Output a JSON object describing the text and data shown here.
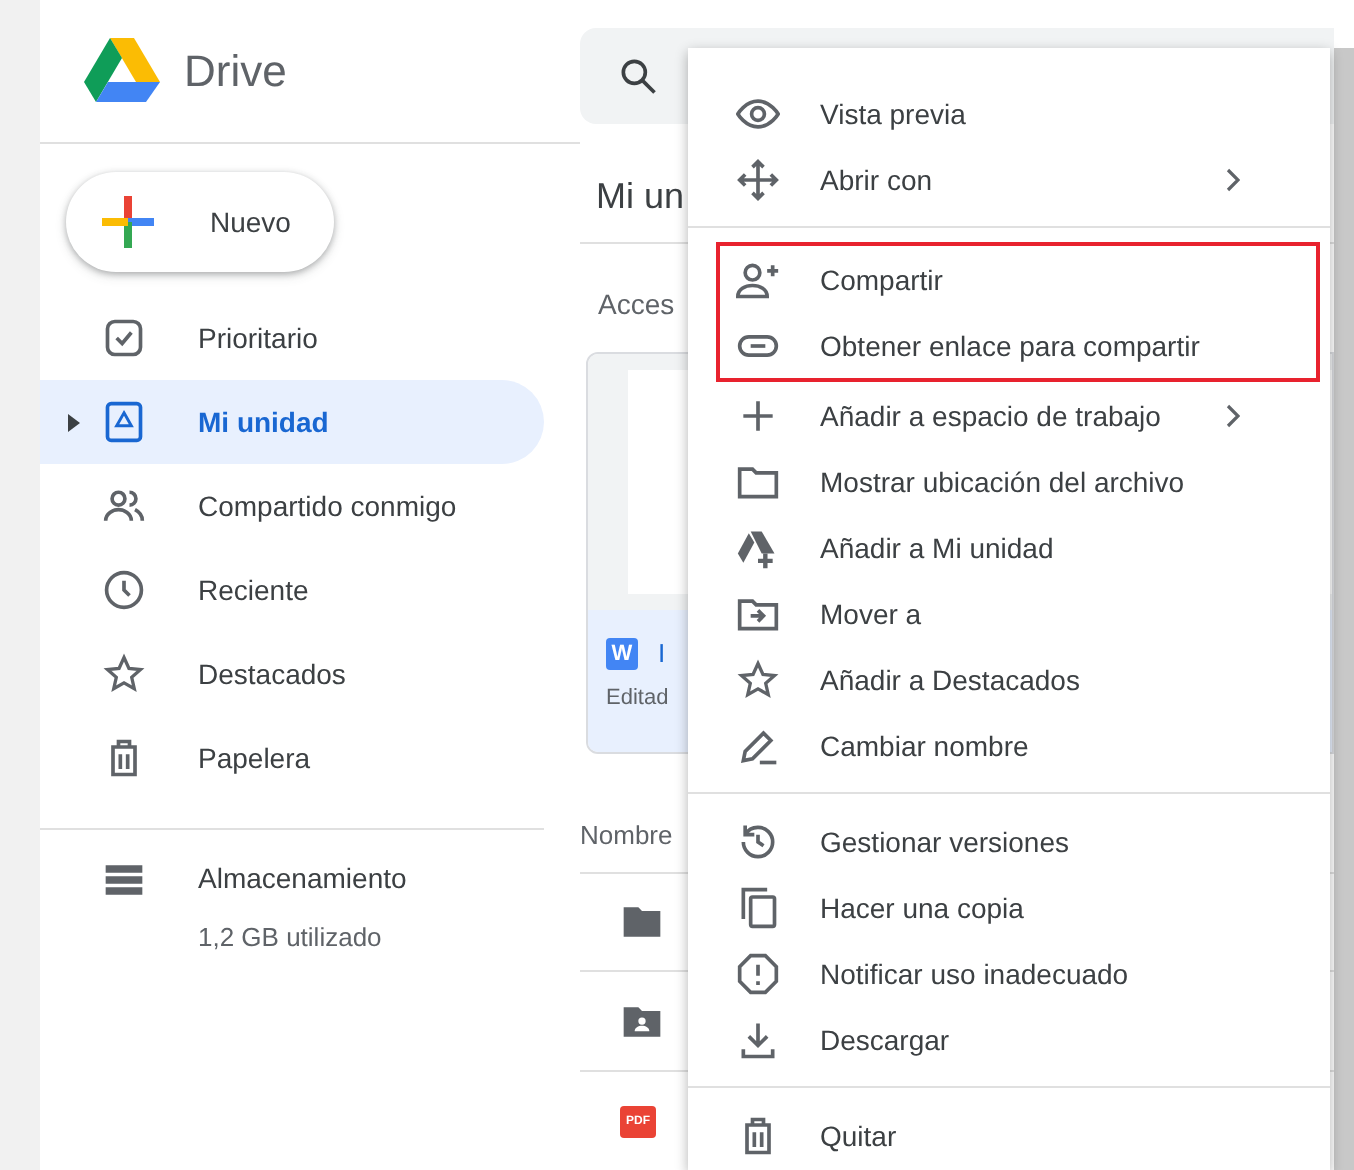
{
  "logo": {
    "name": "Drive"
  },
  "new_button": {
    "label": "Nuevo"
  },
  "sidebar": {
    "items": [
      {
        "label": "Prioritario",
        "selected": false
      },
      {
        "label": "Mi unidad",
        "selected": true
      },
      {
        "label": "Compartido conmigo",
        "selected": false
      },
      {
        "label": "Reciente",
        "selected": false
      },
      {
        "label": "Destacados",
        "selected": false
      },
      {
        "label": "Papelera",
        "selected": false
      }
    ],
    "storage": {
      "label": "Almacenamiento",
      "usage": "1,2 GB utilizado"
    }
  },
  "main": {
    "title": "Mi un",
    "section": "Acces",
    "card": {
      "badge": "W",
      "name": "I",
      "subtitle": "Editad"
    },
    "column": "Nombre",
    "files": [
      {
        "kind": "folder"
      },
      {
        "kind": "shared-folder"
      },
      {
        "kind": "pdf",
        "badge": "PDF"
      }
    ]
  },
  "menu": {
    "sections": [
      {
        "items": [
          {
            "label": "Vista previa",
            "submenu": false,
            "highlighted": false
          },
          {
            "label": "Abrir con",
            "submenu": true,
            "highlighted": false
          }
        ]
      },
      {
        "items": [
          {
            "label": "Compartir",
            "submenu": false,
            "highlighted": true
          },
          {
            "label": "Obtener enlace para compartir",
            "submenu": false,
            "highlighted": true
          },
          {
            "label": "Añadir a espacio de trabajo",
            "submenu": true,
            "highlighted": false
          },
          {
            "label": "Mostrar ubicación del archivo",
            "submenu": false,
            "highlighted": false
          },
          {
            "label": "Añadir a Mi unidad",
            "submenu": false,
            "highlighted": false
          },
          {
            "label": "Mover a",
            "submenu": false,
            "highlighted": false
          },
          {
            "label": "Añadir a Destacados",
            "submenu": false,
            "highlighted": false
          },
          {
            "label": "Cambiar nombre",
            "submenu": false,
            "highlighted": false
          }
        ]
      },
      {
        "items": [
          {
            "label": "Gestionar versiones",
            "submenu": false,
            "highlighted": false
          },
          {
            "label": "Hacer una copia",
            "submenu": false,
            "highlighted": false
          },
          {
            "label": "Notificar uso inadecuado",
            "submenu": false,
            "highlighted": false
          },
          {
            "label": "Descargar",
            "submenu": false,
            "highlighted": false
          }
        ]
      },
      {
        "items": [
          {
            "label": "Quitar",
            "submenu": false,
            "highlighted": false
          }
        ]
      }
    ]
  }
}
